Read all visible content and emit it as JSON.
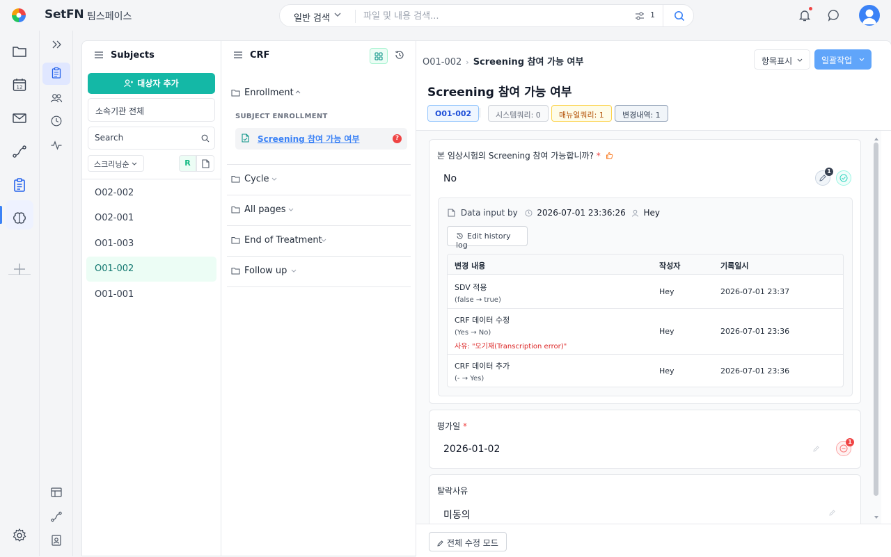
{
  "topbar": {
    "brand": "SetFN",
    "workspace": "팀스페이스",
    "search_mode": "일반 검색",
    "search_placeholder": "파일 및 내용 검색...",
    "filter_count": "1"
  },
  "subjects": {
    "title": "Subjects",
    "add_button": "대상자 추가",
    "org_select": "소속기관 전체",
    "search_placeholder": "Search",
    "sort_select": "스크리닝순",
    "r_button": "R",
    "items": [
      "O02-002",
      "O02-001",
      "O01-003",
      "O01-002",
      "O01-001"
    ],
    "selected": "O01-002"
  },
  "crf": {
    "title": "CRF",
    "sections": [
      "Enrollment",
      "Cycle",
      "All pages",
      "End of Treatment",
      "Follow up"
    ],
    "enrollment_header": "SUBJECT ENROLLMENT",
    "form_item": "Screening 참여 가능 여부",
    "form_query_mark": "?"
  },
  "main": {
    "breadcrumb_subject": "O01-002",
    "breadcrumb_form": "Screening 참여 가능 여부",
    "show_items_button": "항목표시",
    "bulk_button": "일괄작업",
    "title": "Screening 참여 가능 여부",
    "badges": {
      "subject": "O01-002",
      "system_query": "시스템쿼리: 0",
      "manual_query": "매뉴얼쿼리: 1",
      "change_log": "변경내역: 1"
    },
    "q1": {
      "label": "본 임상시험의 Screening 참여 가능합니까?",
      "required": "*",
      "answer": "No",
      "sdv_count": "1"
    },
    "input_info": {
      "label": "Data input by",
      "datetime": "2026-07-01 23:36:26",
      "user": "Hey",
      "history_button": "Edit history log"
    },
    "history_table": {
      "headers": [
        "변경 내용",
        "작성자",
        "기록일시"
      ],
      "rows": [
        {
          "change": "SDV 적용",
          "detail": "(false → true)",
          "reason": "",
          "author": "Hey",
          "date": "2026-07-01 23:37"
        },
        {
          "change": "CRF 데이터 수정",
          "detail": "(Yes → No)",
          "reason": "사유: \"오기재(Transcription error)\"",
          "author": "Hey",
          "date": "2026-07-01 23:36"
        },
        {
          "change": "CRF 데이터 추가",
          "detail": "(- → Yes)",
          "reason": "",
          "author": "Hey",
          "date": "2026-07-01 23:36"
        }
      ]
    },
    "q2": {
      "label": "평가일",
      "required": "*",
      "answer": "2026-01-02",
      "query_count": "1"
    },
    "q3": {
      "label": "탈락사유",
      "answer": "미동의"
    },
    "edit_all_button": "전체 수정 모드"
  },
  "colors": {
    "accent": "#3b82f6",
    "teal": "#14b8a6",
    "danger": "#ef4444"
  }
}
